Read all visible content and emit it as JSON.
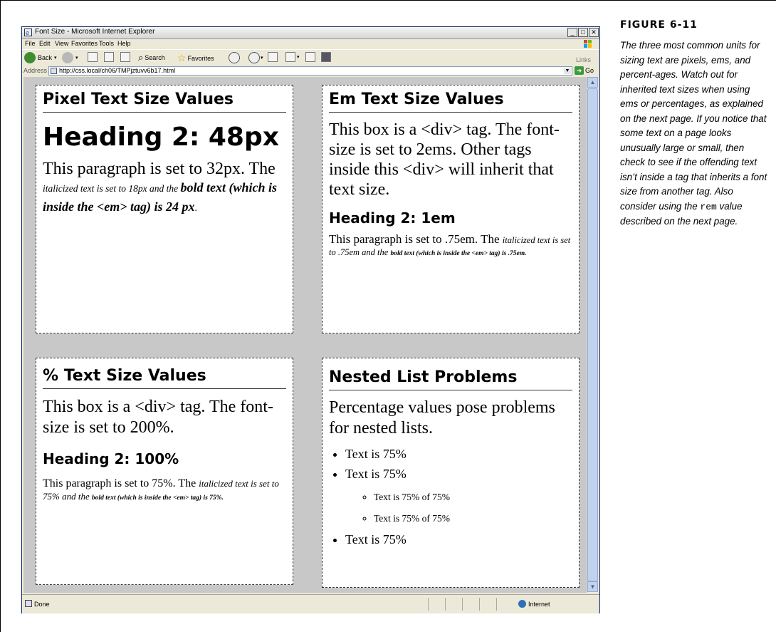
{
  "window": {
    "title": "Font Size - Microsoft Internet Explorer",
    "menus": [
      "File",
      "Edit",
      "View",
      "Favorites",
      "Tools",
      "Help"
    ],
    "toolbar": {
      "back": "Back",
      "search": "Search",
      "favorites": "Favorites",
      "links": "Links"
    },
    "address": {
      "label": "Address",
      "url": "http://css.local/ch06/TMPjztuvv6b17.html",
      "go": "Go"
    },
    "status": {
      "text": "Done",
      "zone": "Internet"
    }
  },
  "boxes": {
    "pixel": {
      "heading": "Pixel Text Size Values",
      "h2": "Heading 2: 48px",
      "p_start": "This paragraph is set to 32px. The ",
      "p_em": "italicized text is set to 18px and the ",
      "p_strong": "bold text (which is inside the <em> tag) is 24 px",
      "p_end": "."
    },
    "em": {
      "heading": "Em Text Size Values",
      "intro": "This box is a <div> tag. The font-size is set to 2ems. Other tags inside this <div> will inherit that text size.",
      "h2": "Heading 2: 1em",
      "p_start": "This paragraph is set to .75em. The ",
      "p_em": "italicized text is set to .75em and the ",
      "p_strong": "bold text (which is inside the <em> tag) is .75em",
      "p_end": "."
    },
    "percent": {
      "heading": "% Text Size Values",
      "intro": "This box is a <div> tag. The font-size is set to 200%.",
      "h2": "Heading 2: 100%",
      "p_start": "This paragraph is set to 75%. The ",
      "p_em": "italicized text is set to 75% and the ",
      "p_strong": "bold text (which is inside the <em> tag) is 75%",
      "p_end": "."
    },
    "nested": {
      "heading": "Nested List Problems",
      "intro": "Percentage values pose problems for nested lists.",
      "item1": "Text is 75%",
      "item2": "Text is 75%",
      "sub1": "Text is 75% of 75%",
      "sub2": "Text is 75% of 75%",
      "item3": "Text is 75%"
    }
  },
  "caption": {
    "title": "FIGURE 6-11",
    "text_before": "The three most common units for sizing text are pixels, ems, and percent-ages. Watch out for inherited text sizes when using ems or percentages, as explained on the next page. If you notice that some text on a page looks unusually large or small, then check to see if the offending text isn’t inside a tag that inherits a font size from another tag. Also consider using the ",
    "code": "rem",
    "text_after": " value described on the next page."
  }
}
